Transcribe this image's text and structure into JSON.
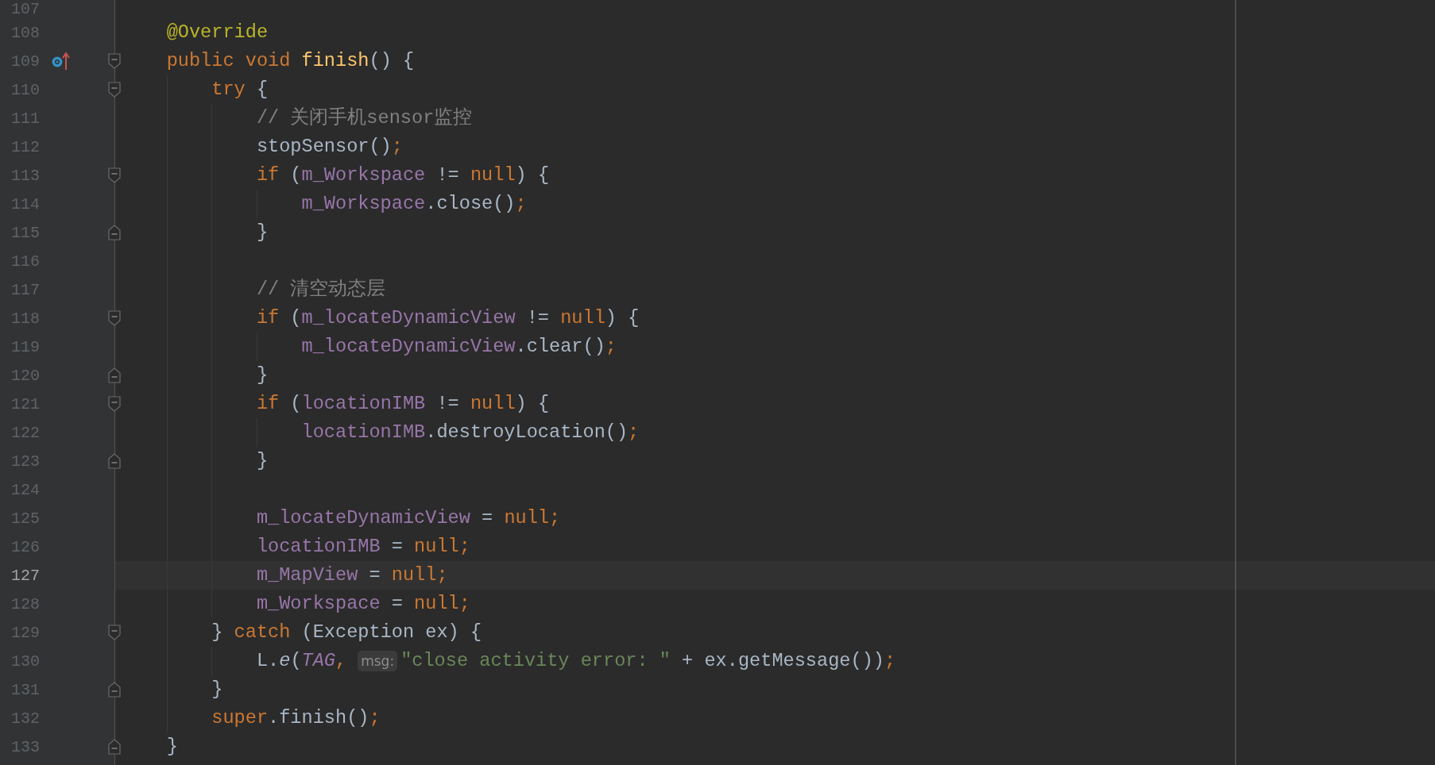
{
  "editor": {
    "lines": [
      {
        "number": "107",
        "current": false,
        "overridden": false,
        "fold_open": false,
        "fold_close": false
      },
      {
        "number": "108",
        "current": false,
        "overridden": false,
        "fold_open": false,
        "fold_close": false,
        "tokens": [
          {
            "kind": "annotation",
            "text": "@Override"
          }
        ]
      },
      {
        "number": "109",
        "current": false,
        "overridden": true,
        "fold_open": true,
        "fold_close": false,
        "tokens": [
          {
            "kind": "keyword",
            "text": "public void"
          },
          {
            "kind": "method",
            "text": " finish"
          },
          {
            "kind": "plain",
            "text": "() {"
          }
        ],
        "children": [
          {
            "number": "110",
            "current": false,
            "overridden": false,
            "fold_open": true,
            "fold_close": false,
            "tokens": [
              {
                "kind": "keyword",
                "text": "try"
              },
              {
                "kind": "plain",
                "text": " {"
              }
            ],
            "children": [
              {
                "number": "111",
                "current": false,
                "overridden": false,
                "fold_open": false,
                "fold_close": false,
                "tokens": [
                  {
                    "kind": "comment",
                    "text": "// 关闭手机sensor监控"
                  }
                ]
              },
              {
                "number": "112",
                "current": false,
                "overridden": false,
                "fold_open": false,
                "fold_close": false,
                "tokens": [
                  {
                    "kind": "plain",
                    "text": "stopSensor()"
                  },
                  {
                    "kind": "keyword",
                    "text": ";"
                  }
                ]
              },
              {
                "number": "113",
                "current": false,
                "overridden": false,
                "fold_open": true,
                "fold_close": false,
                "tokens": [
                  {
                    "kind": "keyword",
                    "text": "if"
                  },
                  {
                    "kind": "plain",
                    "text": " ("
                  },
                  {
                    "kind": "field",
                    "text": "m_Workspace"
                  },
                  {
                    "kind": "plain",
                    "text": " != "
                  },
                  {
                    "kind": "keyword",
                    "text": "null"
                  },
                  {
                    "kind": "plain",
                    "text": ") {"
                  }
                ],
                "children": [
                  {
                    "number": "114",
                    "current": false,
                    "overridden": false,
                    "fold_open": false,
                    "fold_close": false,
                    "tokens": [
                      {
                        "kind": "field",
                        "text": "m_Workspace"
                      },
                      {
                        "kind": "plain",
                        "text": ".close()"
                      },
                      {
                        "kind": "keyword",
                        "text": ";"
                      }
                    ]
                  }
                ]
              },
              {
                "number": "115",
                "current": false,
                "overridden": false,
                "fold_open": false,
                "fold_close": true,
                "tokens": [
                  {
                    "kind": "plain",
                    "text": "}"
                  }
                ]
              },
              {
                "number": "116",
                "current": false,
                "overridden": false,
                "fold_open": false,
                "fold_close": false
              },
              {
                "number": "117",
                "current": false,
                "overridden": false,
                "fold_open": false,
                "fold_close": false,
                "tokens": [
                  {
                    "kind": "comment",
                    "text": "// 清空动态层"
                  }
                ]
              },
              {
                "number": "118",
                "current": false,
                "overridden": false,
                "fold_open": true,
                "fold_close": false,
                "tokens": [
                  {
                    "kind": "keyword",
                    "text": "if"
                  },
                  {
                    "kind": "plain",
                    "text": " ("
                  },
                  {
                    "kind": "field",
                    "text": "m_locateDynamicView"
                  },
                  {
                    "kind": "plain",
                    "text": " != "
                  },
                  {
                    "kind": "keyword",
                    "text": "null"
                  },
                  {
                    "kind": "plain",
                    "text": ") {"
                  }
                ],
                "children": [
                  {
                    "number": "119",
                    "current": false,
                    "overridden": false,
                    "fold_open": false,
                    "fold_close": false,
                    "tokens": [
                      {
                        "kind": "field",
                        "text": "m_locateDynamicView"
                      },
                      {
                        "kind": "plain",
                        "text": ".clear()"
                      },
                      {
                        "kind": "keyword",
                        "text": ";"
                      }
                    ]
                  }
                ]
              },
              {
                "number": "120",
                "current": false,
                "overridden": false,
                "fold_open": false,
                "fold_close": true,
                "tokens": [
                  {
                    "kind": "plain",
                    "text": "}"
                  }
                ]
              },
              {
                "number": "121",
                "current": false,
                "overridden": false,
                "fold_open": true,
                "fold_close": false,
                "tokens": [
                  {
                    "kind": "keyword",
                    "text": "if"
                  },
                  {
                    "kind": "plain",
                    "text": " ("
                  },
                  {
                    "kind": "field",
                    "text": "locationIMB"
                  },
                  {
                    "kind": "plain",
                    "text": " != "
                  },
                  {
                    "kind": "keyword",
                    "text": "null"
                  },
                  {
                    "kind": "plain",
                    "text": ") {"
                  }
                ],
                "children": [
                  {
                    "number": "122",
                    "current": false,
                    "overridden": false,
                    "fold_open": false,
                    "fold_close": false,
                    "tokens": [
                      {
                        "kind": "field",
                        "text": "locationIMB"
                      },
                      {
                        "kind": "plain",
                        "text": ".destroyLocation()"
                      },
                      {
                        "kind": "keyword",
                        "text": ";"
                      }
                    ]
                  }
                ]
              },
              {
                "number": "123",
                "current": false,
                "overridden": false,
                "fold_open": false,
                "fold_close": true,
                "tokens": [
                  {
                    "kind": "plain",
                    "text": "}"
                  }
                ]
              },
              {
                "number": "124",
                "current": false,
                "overridden": false,
                "fold_open": false,
                "fold_close": false
              },
              {
                "number": "125",
                "current": false,
                "overridden": false,
                "fold_open": false,
                "fold_close": false,
                "tokens": [
                  {
                    "kind": "field",
                    "text": "m_locateDynamicView"
                  },
                  {
                    "kind": "plain",
                    "text": " = "
                  },
                  {
                    "kind": "keyword",
                    "text": "null;"
                  }
                ]
              },
              {
                "number": "126",
                "current": false,
                "overridden": false,
                "fold_open": false,
                "fold_close": false,
                "tokens": [
                  {
                    "kind": "field",
                    "text": "locationIMB"
                  },
                  {
                    "kind": "plain",
                    "text": " = "
                  },
                  {
                    "kind": "keyword",
                    "text": "null;"
                  }
                ]
              },
              {
                "number": "127",
                "current": true,
                "overridden": false,
                "fold_open": false,
                "fold_close": false,
                "tokens": [
                  {
                    "kind": "field",
                    "text": "m_MapView"
                  },
                  {
                    "kind": "plain",
                    "text": " = "
                  },
                  {
                    "kind": "keyword",
                    "text": "null;"
                  }
                ]
              },
              {
                "number": "128",
                "current": false,
                "overridden": false,
                "fold_open": false,
                "fold_close": false,
                "tokens": [
                  {
                    "kind": "field",
                    "text": "m_Workspace"
                  },
                  {
                    "kind": "plain",
                    "text": " = "
                  },
                  {
                    "kind": "keyword",
                    "text": "null;"
                  }
                ]
              }
            ]
          },
          {
            "number": "129",
            "current": false,
            "overridden": false,
            "fold_open": true,
            "fold_close": false,
            "tokens": [
              {
                "kind": "plain",
                "text": "} "
              },
              {
                "kind": "keyword",
                "text": "catch"
              },
              {
                "kind": "plain",
                "text": " (Exception ex) {"
              }
            ],
            "children": [
              {
                "number": "130",
                "current": false,
                "overridden": false,
                "fold_open": false,
                "fold_close": false,
                "tokens": [
                  {
                    "kind": "plain",
                    "text": "L."
                  },
                  {
                    "kind": "italic",
                    "text": "e"
                  },
                  {
                    "kind": "plain",
                    "text": "("
                  },
                  {
                    "kind": "constant",
                    "text": "TAG"
                  },
                  {
                    "kind": "keyword",
                    "text": ","
                  },
                  {
                    "kind": "hint",
                    "text": "msg:"
                  },
                  {
                    "kind": "string",
                    "text": "\"close activity error: \""
                  },
                  {
                    "kind": "plain",
                    "text": " + ex.getMessage())"
                  },
                  {
                    "kind": "keyword",
                    "text": ";"
                  }
                ]
              }
            ]
          },
          {
            "number": "131",
            "current": false,
            "overridden": false,
            "fold_open": false,
            "fold_close": true,
            "tokens": [
              {
                "kind": "plain",
                "text": "}"
              }
            ]
          },
          {
            "number": "132",
            "current": false,
            "overridden": false,
            "fold_open": false,
            "fold_close": false,
            "tokens": [
              {
                "kind": "keyword",
                "text": "super"
              },
              {
                "kind": "plain",
                "text": ".finish()"
              },
              {
                "kind": "keyword",
                "text": ";"
              }
            ]
          }
        ]
      },
      {
        "number": "133",
        "current": false,
        "overridden": false,
        "fold_open": false,
        "fold_close": true,
        "tokens": [
          {
            "kind": "plain",
            "text": "}"
          }
        ]
      }
    ]
  }
}
